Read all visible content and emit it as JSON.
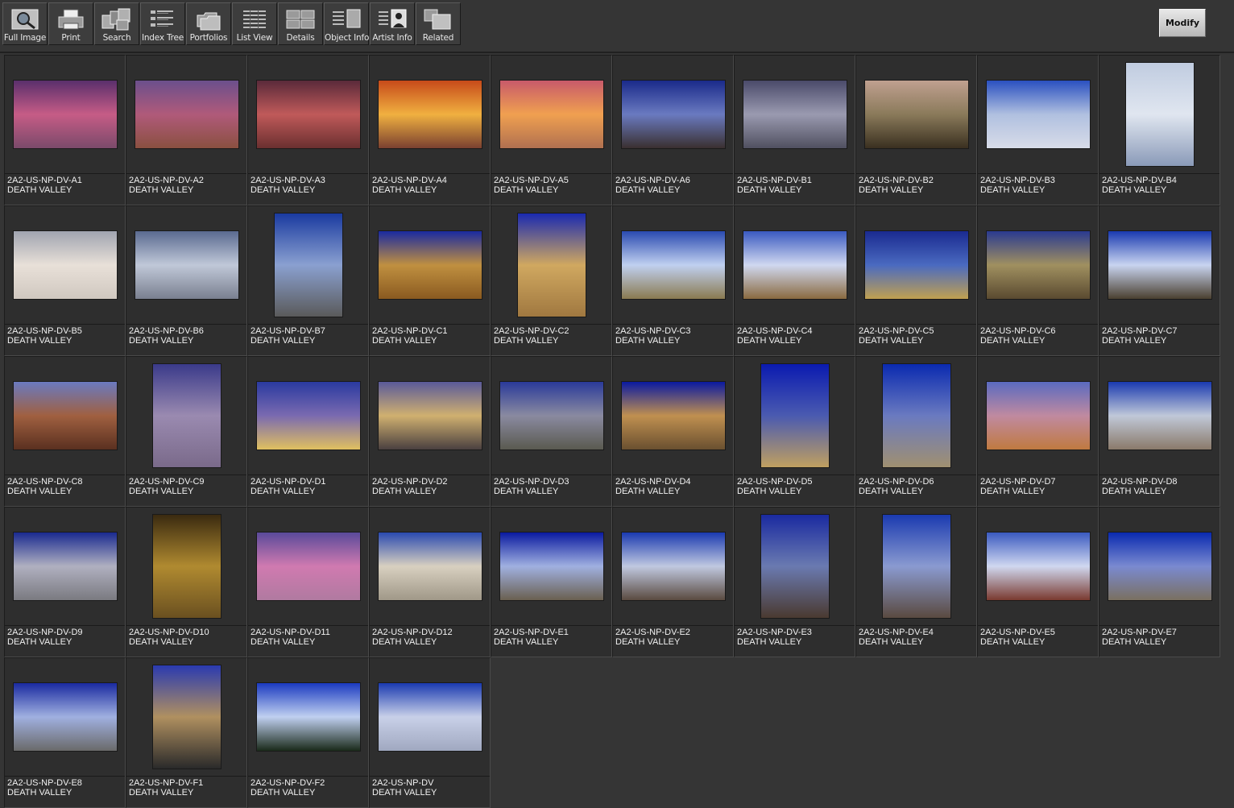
{
  "toolbar": {
    "buttons": [
      {
        "label": "Full Image",
        "icon": "magnifier-icon"
      },
      {
        "label": "Print",
        "icon": "printer-icon"
      },
      {
        "label": "Search",
        "icon": "search-icon"
      },
      {
        "label": "Index Tree",
        "icon": "index-tree-icon"
      },
      {
        "label": "Portfolios",
        "icon": "folders-icon"
      },
      {
        "label": "List View",
        "icon": "list-view-icon"
      },
      {
        "label": "Details",
        "icon": "details-icon"
      },
      {
        "label": "Object Info",
        "icon": "object-info-icon"
      },
      {
        "label": "Artist  Info",
        "icon": "artist-info-icon"
      },
      {
        "label": "Related",
        "icon": "related-icon"
      }
    ],
    "modify_label": "Modify"
  },
  "colors": {
    "background": "#353535",
    "cell": "#2e2e2e",
    "text": "#f2f2f2"
  },
  "thumbnails": [
    {
      "code": "2A2-US-NP-DV-A1",
      "title": "DEATH VALLEY",
      "orientation": "landscape",
      "palette": [
        "#5a2f6c",
        "#c65c86",
        "#7a4a6a"
      ]
    },
    {
      "code": "2A2-US-NP-DV-A2",
      "title": "DEATH VALLEY",
      "orientation": "landscape",
      "palette": [
        "#6b4f8c",
        "#b05a7a",
        "#8a5040"
      ]
    },
    {
      "code": "2A2-US-NP-DV-A3",
      "title": "DEATH VALLEY",
      "orientation": "landscape",
      "palette": [
        "#5a2a3a",
        "#c05a5a",
        "#6a3030"
      ]
    },
    {
      "code": "2A2-US-NP-DV-A4",
      "title": "DEATH VALLEY",
      "orientation": "landscape",
      "palette": [
        "#c64a1a",
        "#f0b040",
        "#7a4030"
      ]
    },
    {
      "code": "2A2-US-NP-DV-A5",
      "title": "DEATH VALLEY",
      "orientation": "landscape",
      "palette": [
        "#c85a6a",
        "#f0a050",
        "#b07050"
      ]
    },
    {
      "code": "2A2-US-NP-DV-A6",
      "title": "DEATH VALLEY",
      "orientation": "landscape",
      "palette": [
        "#1a2a8a",
        "#6a7ac0",
        "#3a3030"
      ]
    },
    {
      "code": "2A2-US-NP-DV-B1",
      "title": "DEATH VALLEY",
      "orientation": "landscape",
      "palette": [
        "#4a4a6a",
        "#9a9ab0",
        "#505060"
      ]
    },
    {
      "code": "2A2-US-NP-DV-B2",
      "title": "DEATH VALLEY",
      "orientation": "landscape",
      "palette": [
        "#c0a090",
        "#8a7a5a",
        "#3a3020"
      ]
    },
    {
      "code": "2A2-US-NP-DV-B3",
      "title": "DEATH VALLEY",
      "orientation": "landscape",
      "palette": [
        "#2a50c0",
        "#b0c0e0",
        "#d8dce8"
      ]
    },
    {
      "code": "2A2-US-NP-DV-B4",
      "title": "DEATH VALLEY",
      "orientation": "portrait",
      "palette": [
        "#c0cce0",
        "#e0e6f0",
        "#8a9ab8"
      ]
    },
    {
      "code": "2A2-US-NP-DV-B5",
      "title": "DEATH VALLEY",
      "orientation": "landscape",
      "palette": [
        "#a0a4b0",
        "#e8e0d8",
        "#d0c8c0"
      ]
    },
    {
      "code": "2A2-US-NP-DV-B6",
      "title": "DEATH VALLEY",
      "orientation": "landscape",
      "palette": [
        "#5a6a90",
        "#c0c8d8",
        "#7a8090"
      ]
    },
    {
      "code": "2A2-US-NP-DV-B7",
      "title": "DEATH VALLEY",
      "orientation": "portrait",
      "palette": [
        "#1a3aa0",
        "#8aa0d0",
        "#5a5a5a"
      ]
    },
    {
      "code": "2A2-US-NP-DV-C1",
      "title": "DEATH VALLEY",
      "orientation": "landscape",
      "palette": [
        "#1a2aa0",
        "#c09040",
        "#8a5a20"
      ]
    },
    {
      "code": "2A2-US-NP-DV-C2",
      "title": "DEATH VALLEY",
      "orientation": "portrait",
      "palette": [
        "#1a2ab0",
        "#d0a860",
        "#a07840"
      ]
    },
    {
      "code": "2A2-US-NP-DV-C3",
      "title": "DEATH VALLEY",
      "orientation": "landscape",
      "palette": [
        "#2a4ab0",
        "#c0d0f0",
        "#8a7a50"
      ]
    },
    {
      "code": "2A2-US-NP-DV-C4",
      "title": "DEATH VALLEY",
      "orientation": "landscape",
      "palette": [
        "#3a5ac0",
        "#d0d8f0",
        "#8a6a40"
      ]
    },
    {
      "code": "2A2-US-NP-DV-C5",
      "title": "DEATH VALLEY",
      "orientation": "landscape",
      "palette": [
        "#1a2a90",
        "#4a6ac0",
        "#c0a050"
      ]
    },
    {
      "code": "2A2-US-NP-DV-C6",
      "title": "DEATH VALLEY",
      "orientation": "landscape",
      "palette": [
        "#2a3a90",
        "#a09060",
        "#5a4a30"
      ]
    },
    {
      "code": "2A2-US-NP-DV-C7",
      "title": "DEATH VALLEY",
      "orientation": "landscape",
      "palette": [
        "#1a3ab0",
        "#c8d4f0",
        "#4a4030"
      ]
    },
    {
      "code": "2A2-US-NP-DV-C8",
      "title": "DEATH VALLEY",
      "orientation": "landscape",
      "palette": [
        "#6a7ac0",
        "#a06040",
        "#5a3020"
      ]
    },
    {
      "code": "2A2-US-NP-DV-C9",
      "title": "DEATH VALLEY",
      "orientation": "portrait",
      "palette": [
        "#3a3a8a",
        "#9a8ab0",
        "#7a6a8a"
      ]
    },
    {
      "code": "2A2-US-NP-DV-D1",
      "title": "DEATH VALLEY",
      "orientation": "landscape",
      "palette": [
        "#2a3aa0",
        "#7a6ab0",
        "#e0c060"
      ]
    },
    {
      "code": "2A2-US-NP-DV-D2",
      "title": "DEATH VALLEY",
      "orientation": "landscape",
      "palette": [
        "#5a5a9a",
        "#d0b070",
        "#4a4040"
      ]
    },
    {
      "code": "2A2-US-NP-DV-D3",
      "title": "DEATH VALLEY",
      "orientation": "landscape",
      "palette": [
        "#2a3a9a",
        "#8a8aa0",
        "#5a5a50"
      ]
    },
    {
      "code": "2A2-US-NP-DV-D4",
      "title": "DEATH VALLEY",
      "orientation": "landscape",
      "palette": [
        "#0a1aa0",
        "#c09050",
        "#6a5030"
      ]
    },
    {
      "code": "2A2-US-NP-DV-D5",
      "title": "DEATH VALLEY",
      "orientation": "portrait",
      "palette": [
        "#0a1ab0",
        "#4a5ab0",
        "#c0a060"
      ]
    },
    {
      "code": "2A2-US-NP-DV-D6",
      "title": "DEATH VALLEY",
      "orientation": "portrait",
      "palette": [
        "#0a2ab0",
        "#6a7ac0",
        "#a09070"
      ]
    },
    {
      "code": "2A2-US-NP-DV-D7",
      "title": "DEATH VALLEY",
      "orientation": "landscape",
      "palette": [
        "#5a6ac0",
        "#c08aa0",
        "#c07a40"
      ]
    },
    {
      "code": "2A2-US-NP-DV-D8",
      "title": "DEATH VALLEY",
      "orientation": "landscape",
      "palette": [
        "#1a3ab0",
        "#c0c8d8",
        "#8a7a6a"
      ]
    },
    {
      "code": "2A2-US-NP-DV-D9",
      "title": "DEATH VALLEY",
      "orientation": "landscape",
      "palette": [
        "#1a2a90",
        "#b0b0c0",
        "#7a7a80"
      ]
    },
    {
      "code": "2A2-US-NP-DV-D10",
      "title": "DEATH VALLEY",
      "orientation": "portrait",
      "palette": [
        "#3a2a10",
        "#b08a30",
        "#6a5020"
      ]
    },
    {
      "code": "2A2-US-NP-DV-D11",
      "title": "DEATH VALLEY",
      "orientation": "landscape",
      "palette": [
        "#5a4a9a",
        "#d07ab0",
        "#b07aa0"
      ]
    },
    {
      "code": "2A2-US-NP-DV-D12",
      "title": "DEATH VALLEY",
      "orientation": "landscape",
      "palette": [
        "#2a4ab0",
        "#d8d0c0",
        "#a09888"
      ]
    },
    {
      "code": "2A2-US-NP-DV-E1",
      "title": "DEATH VALLEY",
      "orientation": "landscape",
      "palette": [
        "#0a1aa0",
        "#a0b0e0",
        "#6a6050"
      ]
    },
    {
      "code": "2A2-US-NP-DV-E2",
      "title": "DEATH VALLEY",
      "orientation": "landscape",
      "palette": [
        "#1a3ab0",
        "#c0c8e0",
        "#5a4a40"
      ]
    },
    {
      "code": "2A2-US-NP-DV-E3",
      "title": "DEATH VALLEY",
      "orientation": "portrait",
      "palette": [
        "#1a2aa0",
        "#6a7ab0",
        "#4a3a30"
      ]
    },
    {
      "code": "2A2-US-NP-DV-E4",
      "title": "DEATH VALLEY",
      "orientation": "portrait",
      "palette": [
        "#1a3ab0",
        "#8a9ad0",
        "#5a4a40"
      ]
    },
    {
      "code": "2A2-US-NP-DV-E5",
      "title": "DEATH VALLEY",
      "orientation": "landscape",
      "palette": [
        "#3a5ac0",
        "#d0d8f0",
        "#7a3a30"
      ]
    },
    {
      "code": "2A2-US-NP-DV-E7",
      "title": "DEATH VALLEY",
      "orientation": "landscape",
      "palette": [
        "#0a2ab0",
        "#7a8ad0",
        "#7a7060"
      ]
    },
    {
      "code": "2A2-US-NP-DV-E8",
      "title": "DEATH VALLEY",
      "orientation": "landscape",
      "palette": [
        "#1a2aa0",
        "#a0b0e0",
        "#6a6a6a"
      ]
    },
    {
      "code": "2A2-US-NP-DV-F1",
      "title": "DEATH VALLEY",
      "orientation": "portrait",
      "palette": [
        "#2a3ab0",
        "#b09060",
        "#2a2a2a"
      ]
    },
    {
      "code": "2A2-US-NP-DV-F2",
      "title": "DEATH VALLEY",
      "orientation": "landscape",
      "palette": [
        "#1a3ac0",
        "#c0d0f0",
        "#1a2a1a"
      ]
    },
    {
      "code": "2A2-US-NP-DV",
      "title": "DEATH VALLEY",
      "orientation": "landscape",
      "palette": [
        "#1a3ab0",
        "#c8d0e8",
        "#a0a8c0"
      ]
    }
  ]
}
